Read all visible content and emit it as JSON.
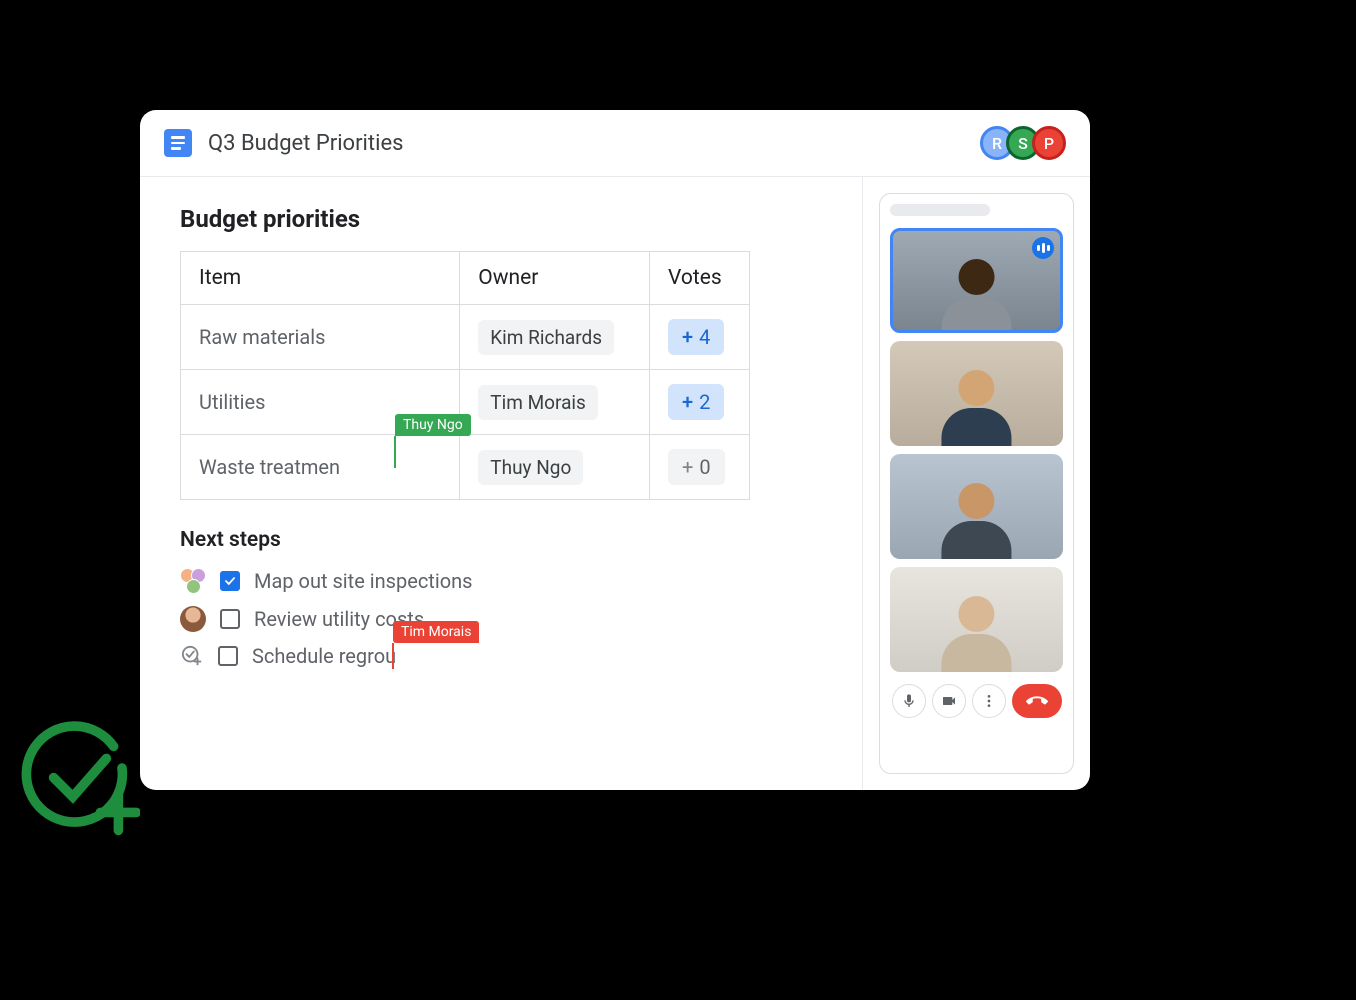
{
  "header": {
    "title": "Q3 Budget Priorities",
    "collaborators": [
      {
        "initial": "R",
        "color": "#8ab4f8"
      },
      {
        "initial": "S",
        "color": "#34a853"
      },
      {
        "initial": "P",
        "color": "#ea4335"
      }
    ]
  },
  "sections": {
    "priorities_title": "Budget priorities",
    "table": {
      "headers": {
        "item": "Item",
        "owner": "Owner",
        "votes": "Votes"
      },
      "rows": [
        {
          "item": "Raw materials",
          "owner": "Kim Richards",
          "votes": 4,
          "vote_active": true
        },
        {
          "item": "Utilities",
          "owner": "Tim Morais",
          "votes": 2,
          "vote_active": true
        },
        {
          "item": "Waste treatmen",
          "owner": "Thuy Ngo",
          "votes": 0,
          "vote_active": false
        }
      ]
    },
    "cursors": {
      "green_label": "Thuy Ngo",
      "red_label": "Tim Morais"
    },
    "next_steps_title": "Next steps",
    "steps": [
      {
        "text": "Map out site inspections",
        "checked": true,
        "assignee_type": "multi"
      },
      {
        "text": "Review utility costs",
        "checked": false,
        "assignee_type": "single"
      },
      {
        "text": "Schedule regrou",
        "checked": false,
        "assignee_type": "unassigned"
      }
    ]
  },
  "video_call": {
    "participants": 4,
    "active_speaker_index": 0
  }
}
